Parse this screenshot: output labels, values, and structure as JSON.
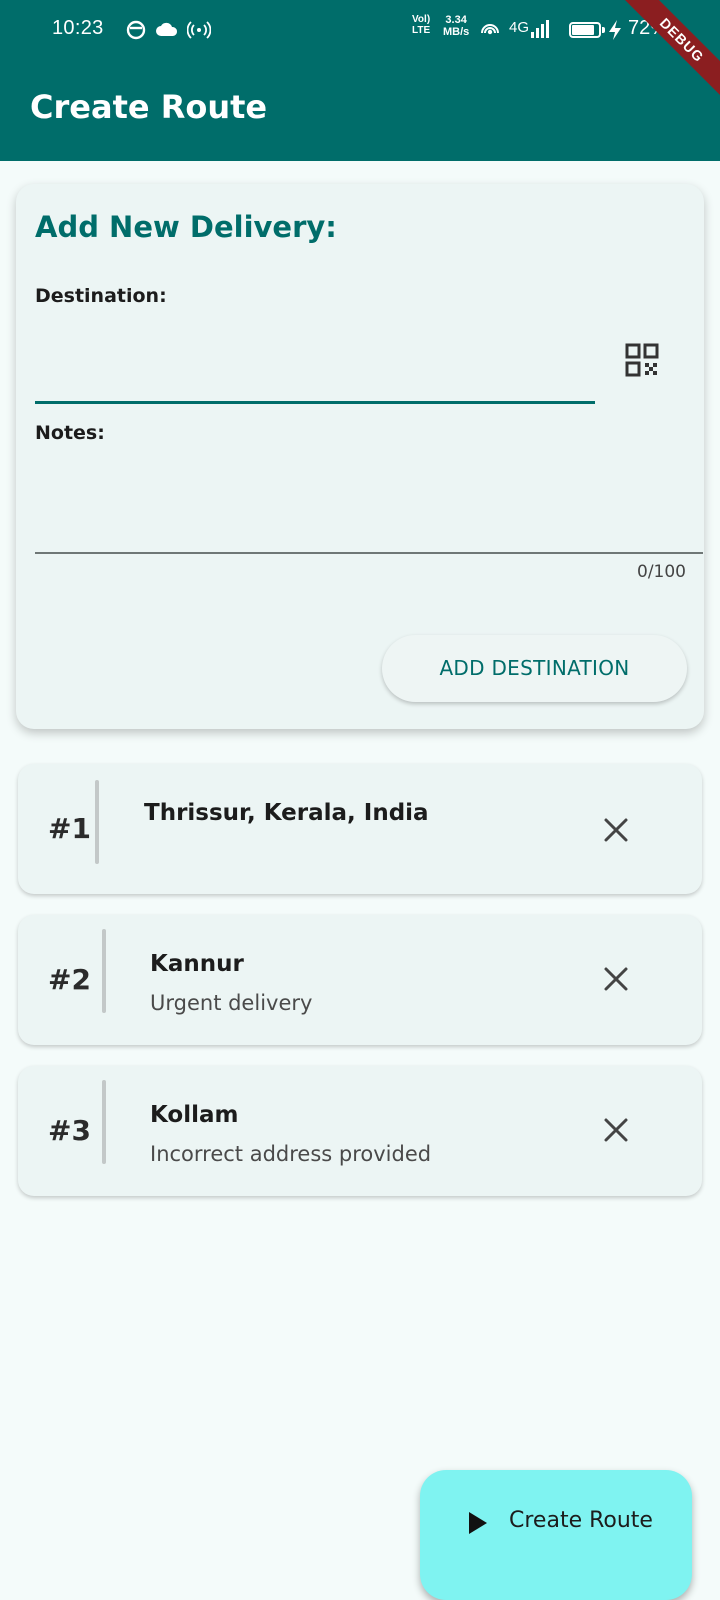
{
  "status_bar": {
    "time": "10:23",
    "network_label_top": "Vol)",
    "network_label_bottom": "LTE",
    "speed_value": "3.34",
    "speed_unit": "MB/s",
    "network_type": "4G",
    "battery_percent": "72%",
    "icons": [
      "notification-icon",
      "cloud-icon",
      "hotspot-icon",
      "wifi-call-icon",
      "signal-icon",
      "battery-icon",
      "charging-icon"
    ]
  },
  "debug_banner": "DEBUG",
  "app_bar": {
    "title": "Create Route"
  },
  "form": {
    "title": "Add New Delivery:",
    "destination_label": "Destination:",
    "destination_value": "",
    "qr_icon": "qr-code-icon",
    "notes_label": "Notes:",
    "notes_value": "",
    "notes_counter": "0/100",
    "add_button_label": "ADD DESTINATION"
  },
  "deliveries": [
    {
      "number": "#1",
      "name": "Thrissur, Kerala, India",
      "note": ""
    },
    {
      "number": "#2",
      "name": "Kannur",
      "note": "Urgent delivery"
    },
    {
      "number": "#3",
      "name": "Kollam",
      "note": "Incorrect address provided"
    }
  ],
  "fab": {
    "label": "Create Route",
    "icon": "play-icon"
  },
  "colors": {
    "primary": "#006d6a",
    "background": "#f4fbfa",
    "card": "#ecf5f4",
    "fab": "#7ff3f1",
    "debug": "#8b1e20"
  }
}
